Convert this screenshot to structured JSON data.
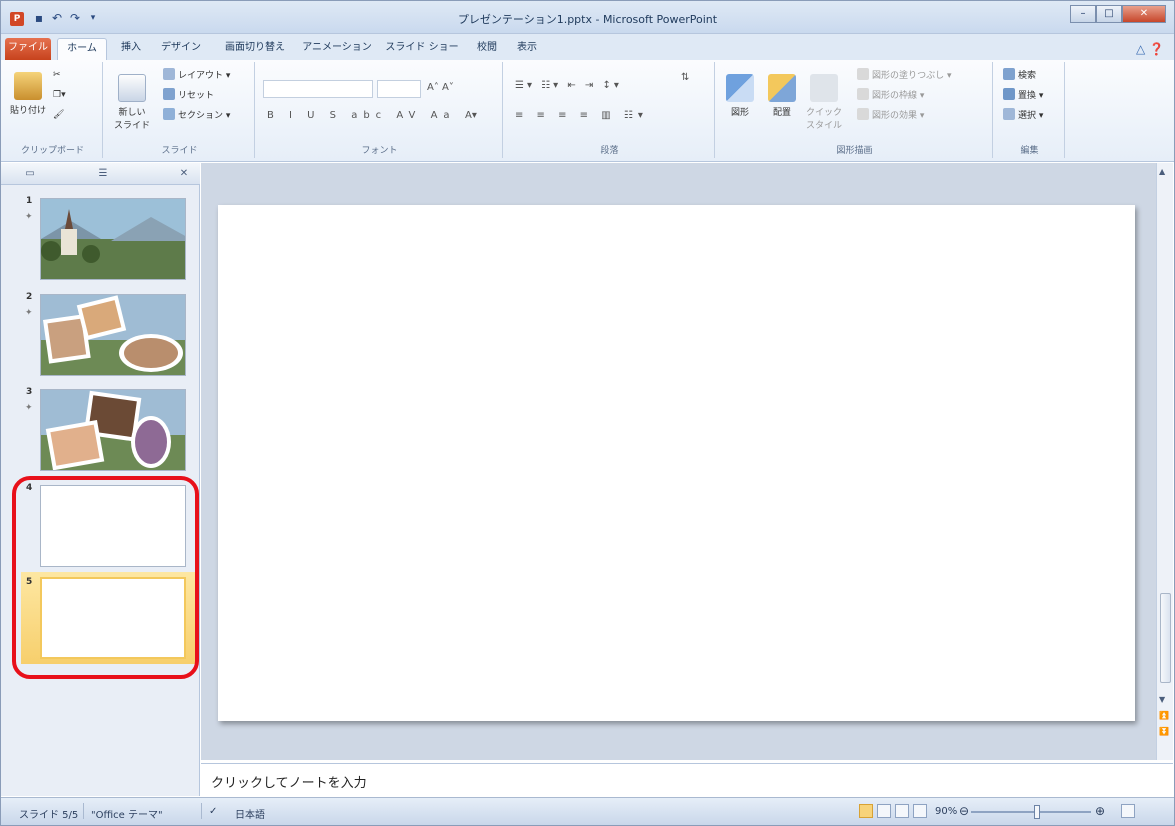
{
  "window": {
    "title": "プレゼンテーション1.pptx - Microsoft PowerPoint",
    "app_icon": "P",
    "quick_access": [
      "save-icon",
      "undo-icon",
      "redo-icon",
      "customize-icon"
    ],
    "controls": [
      "minimize",
      "maximize",
      "close"
    ]
  },
  "tabs": [
    {
      "label": "ファイル",
      "kind": "file"
    },
    {
      "label": "ホーム",
      "kind": "active"
    },
    {
      "label": "挿入"
    },
    {
      "label": "デザイン"
    },
    {
      "label": "画面切り替え"
    },
    {
      "label": "アニメーション"
    },
    {
      "label": "スライド ショー"
    },
    {
      "label": "校閲"
    },
    {
      "label": "表示"
    }
  ],
  "ribbon": {
    "clipboard": {
      "group": "クリップボード",
      "paste": "貼り付け"
    },
    "slides": {
      "group": "スライド",
      "new_slide": "新しい\nスライド",
      "layout": "レイアウト",
      "reset": "リセット",
      "section": "セクション"
    },
    "font": {
      "group": "フォント"
    },
    "paragraph": {
      "group": "段落"
    },
    "drawing": {
      "group": "図形描画",
      "shapes": "図形",
      "arrange": "配置",
      "quick_styles": "クイック\nスタイル",
      "fill": "図形の塗りつぶし",
      "outline": "図形の枠線",
      "effects": "図形の効果"
    },
    "editing": {
      "group": "編集",
      "find": "検索",
      "replace": "置換",
      "select": "選択"
    }
  },
  "slides": [
    {
      "number": "1",
      "content": "church-landscape-photo"
    },
    {
      "number": "2",
      "content": "photo-collage"
    },
    {
      "number": "3",
      "content": "photo-collage"
    },
    {
      "number": "4",
      "content": "blank"
    },
    {
      "number": "5",
      "content": "blank",
      "selected": true
    }
  ],
  "notes": {
    "placeholder": "クリックしてノートを入力"
  },
  "status": {
    "slide_info": "スライド 5/5",
    "theme": "\"Office テーマ\"",
    "language": "日本語",
    "zoom": "90%",
    "zoom_level": 0.55
  },
  "colors": {
    "highlight": "#e8101a",
    "file_tab": "#c7431d",
    "selection": "#f7cf6c"
  }
}
